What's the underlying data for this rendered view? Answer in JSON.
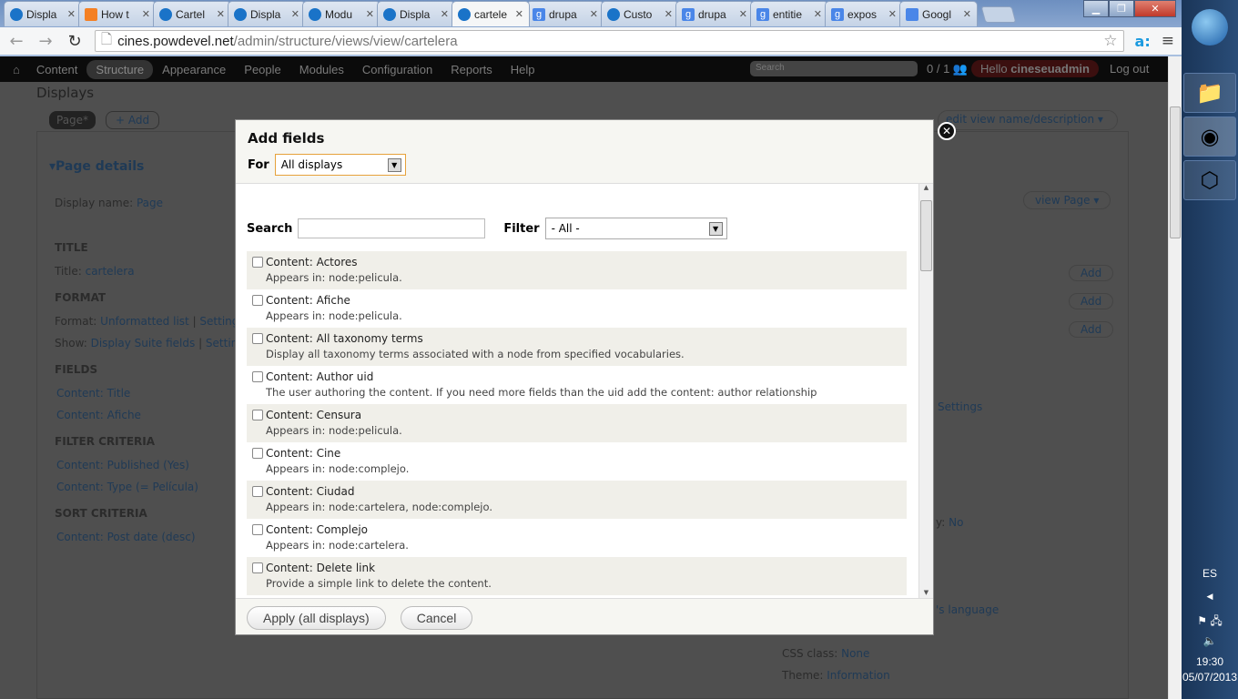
{
  "browser": {
    "tabs": [
      {
        "title": "Displa",
        "icon": "drupal-icon"
      },
      {
        "title": "How t",
        "icon": "stackoverflow-icon"
      },
      {
        "title": "Cartel",
        "icon": "drupal-icon"
      },
      {
        "title": "Displa",
        "icon": "drupal-icon"
      },
      {
        "title": "Modu",
        "icon": "drupal-icon"
      },
      {
        "title": "Displa",
        "icon": "drupal-icon"
      },
      {
        "title": "cartele",
        "icon": "drupal-icon",
        "active": true
      },
      {
        "title": "drupa",
        "icon": "google-icon"
      },
      {
        "title": "Custo",
        "icon": "drupal-icon"
      },
      {
        "title": "drupa",
        "icon": "google-icon"
      },
      {
        "title": "entitie",
        "icon": "google-icon"
      },
      {
        "title": "expos",
        "icon": "google-icon"
      },
      {
        "title": "Googl",
        "icon": "google-translate-icon"
      }
    ],
    "url_host": "cines.powdevel.net",
    "url_path": "/admin/structure/views/view/cartelera"
  },
  "admin_toolbar": {
    "items": [
      "Content",
      "Structure",
      "Appearance",
      "People",
      "Modules",
      "Configuration",
      "Reports",
      "Help"
    ],
    "active": "Structure",
    "search_placeholder": "Search",
    "user_count": "0 / 1",
    "hello": "Hello",
    "username": "cineseuadmin",
    "logout": "Log out"
  },
  "background": {
    "displays_heading": "Displays",
    "page_tab": "Page*",
    "add": "+ Add",
    "edit_view": "edit view name/description",
    "page_details": "Page details",
    "display_name_label": "Display name:",
    "display_name": "Page",
    "view_page": "view Page",
    "title_h": "TITLE",
    "title_label": "Title:",
    "title_value": "cartelera",
    "format_h": "FORMAT",
    "format_label": "Format:",
    "format_value": "Unformatted list",
    "format_settings": "Settings",
    "show_label": "Show:",
    "show_value": "Display Suite fields",
    "show_settings": "Settings",
    "fields_h": "FIELDS",
    "fields": [
      "Content: Title",
      "Content: Afiche"
    ],
    "filter_h": "FILTER CRITERIA",
    "filters": [
      "Content: Published (Yes)",
      "Content: Type (= Película)"
    ],
    "sort_h": "SORT CRITERIA",
    "sorts": [
      "Content: Post date (desc)"
    ],
    "add_btn": "Add",
    "right_settings": "Settings",
    "right_no_suffix": "y:",
    "right_no": "No",
    "right_lang": "'s language",
    "css_label": "CSS class:",
    "css_value": "None",
    "theme_label": "Theme:",
    "theme_value": "Information"
  },
  "modal": {
    "title": "Add fields",
    "for_label": "For",
    "for_value": "All displays",
    "search_label": "Search",
    "search_value": "",
    "filter_label": "Filter",
    "filter_value": "- All -",
    "items": [
      {
        "label": "Content: Actores",
        "desc": "Appears in: node:pelicula."
      },
      {
        "label": "Content: Afiche",
        "desc": "Appears in: node:pelicula."
      },
      {
        "label": "Content: All taxonomy terms",
        "desc": "Display all taxonomy terms associated with a node from specified vocabularies."
      },
      {
        "label": "Content: Author uid",
        "desc": "The user authoring the content. If you need more fields than the uid add the content: author relationship"
      },
      {
        "label": "Content: Censura",
        "desc": "Appears in: node:pelicula."
      },
      {
        "label": "Content: Cine",
        "desc": "Appears in: node:complejo."
      },
      {
        "label": "Content: Ciudad",
        "desc": "Appears in: node:cartelera, node:complejo."
      },
      {
        "label": "Content: Complejo",
        "desc": "Appears in: node:cartelera."
      },
      {
        "label": "Content: Delete link",
        "desc": "Provide a simple link to delete the content."
      }
    ],
    "apply": "Apply (all displays)",
    "cancel": "Cancel"
  },
  "taskbar": {
    "language": "ES",
    "time": "19:30",
    "date": "05/07/2013"
  }
}
